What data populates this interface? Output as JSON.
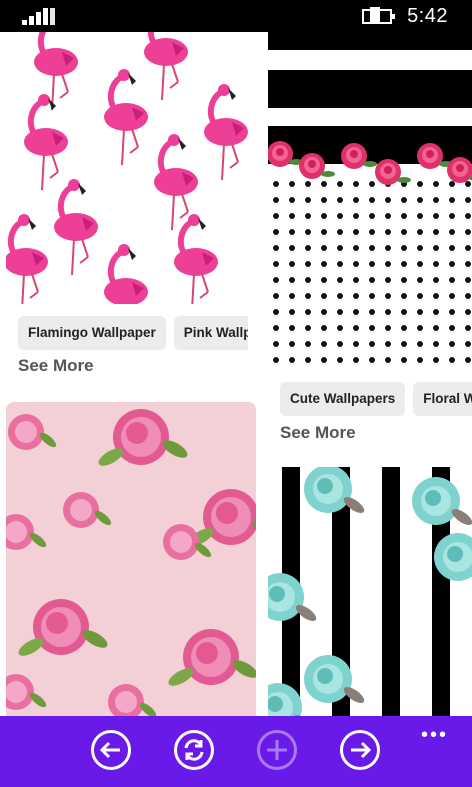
{
  "status": {
    "time": "5:42",
    "signal_icon": "signal-bars-icon",
    "battery_icon": "battery-charging-icon"
  },
  "feed": {
    "left": [
      {
        "image": "flamingo-pattern",
        "chips": [
          "Flamingo Wallpaper",
          "Pink Wallp"
        ],
        "see_more": "See More"
      },
      {
        "image": "pink-peony-pattern"
      }
    ],
    "right": [
      {
        "image": "black-white-stripes-roses-polka-dots",
        "chips": [
          "Cute Wallpapers",
          "Floral W"
        ],
        "see_more": "See More"
      },
      {
        "image": "teal-roses-black-white-stripes"
      }
    ]
  },
  "appbar": {
    "background": "#6a1ae8",
    "buttons": [
      {
        "icon": "back-arrow-icon",
        "enabled": true
      },
      {
        "icon": "refresh-icon",
        "enabled": true
      },
      {
        "icon": "add-icon",
        "enabled": false
      },
      {
        "icon": "forward-arrow-icon",
        "enabled": true
      }
    ],
    "more": "•••"
  }
}
